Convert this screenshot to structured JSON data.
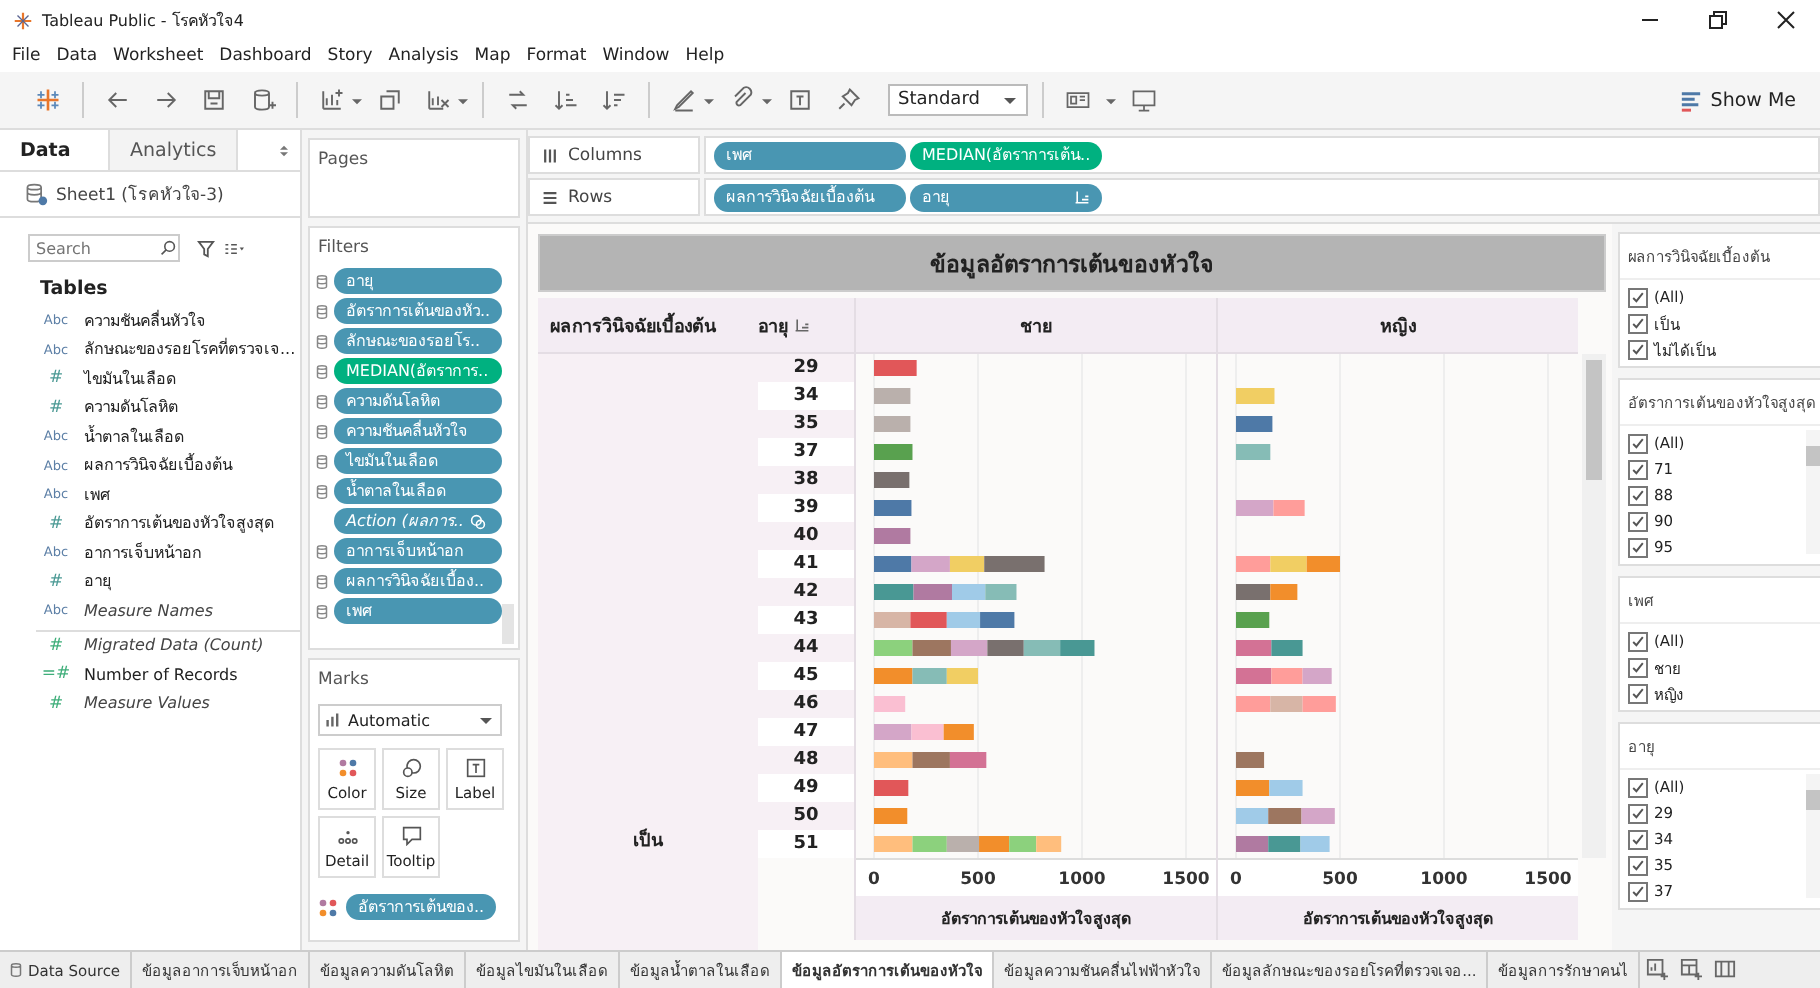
{
  "window": {
    "title": "Tableau Public - โรคหัวใจ4"
  },
  "menu": [
    "File",
    "Data",
    "Worksheet",
    "Dashboard",
    "Story",
    "Analysis",
    "Map",
    "Format",
    "Window",
    "Help"
  ],
  "toolbar": {
    "mark_size": "Standard",
    "show_me": "Show Me"
  },
  "data_pane": {
    "tabs": [
      {
        "label": "Data",
        "selected": true
      },
      {
        "label": "Analytics",
        "selected": false
      }
    ],
    "source": "Sheet1 (โรคหัวใจ-3)",
    "search": {
      "placeholder": "Search"
    },
    "section": "Tables",
    "fields": [
      {
        "type": "Abc",
        "name": "ความชันคลื่นหัวใจ",
        "measure": false,
        "generated": false
      },
      {
        "type": "Abc",
        "name": "ลักษณะของรอยโรคที่ตรวจเจ...",
        "measure": false,
        "generated": false
      },
      {
        "type": "#",
        "name": "ไขมันในเลือด",
        "measure": false,
        "generated": false
      },
      {
        "type": "#",
        "name": "ความดันโลหิต",
        "measure": false,
        "generated": false
      },
      {
        "type": "Abc",
        "name": "น้ำตาลในเลือด",
        "measure": false,
        "generated": false
      },
      {
        "type": "Abc",
        "name": "ผลการวินิจฉัยเบื้องต้น",
        "measure": false,
        "generated": false
      },
      {
        "type": "Abc",
        "name": "เพศ",
        "measure": false,
        "generated": false
      },
      {
        "type": "#",
        "name": "อัตราการเต้นของหัวใจสูงสุด",
        "measure": false,
        "generated": false
      },
      {
        "type": "Abc",
        "name": "อาการเจ็บหน้าอก",
        "measure": false,
        "generated": false
      },
      {
        "type": "#",
        "name": "อายุ",
        "measure": false,
        "generated": false
      },
      {
        "type": "Abc",
        "name": "Measure Names",
        "measure": false,
        "generated": true
      },
      {
        "type": "#",
        "name": "Migrated Data (Count)",
        "measure": true,
        "generated": true
      },
      {
        "type": "=#",
        "name": "Number of Records",
        "measure": true,
        "generated": false
      },
      {
        "type": "#",
        "name": "Measure Values",
        "measure": true,
        "generated": true
      }
    ]
  },
  "pages": {
    "title": "Pages"
  },
  "filters": {
    "title": "Filters",
    "pills": [
      {
        "label": "อายุ",
        "kind": "dimension"
      },
      {
        "label": "อัตราการเต้นของหัว..",
        "kind": "dimension"
      },
      {
        "label": "ลักษณะของรอยโร..",
        "kind": "dimension"
      },
      {
        "label": "MEDIAN(อัตราการ..",
        "kind": "measure"
      },
      {
        "label": "ความดันโลหิต",
        "kind": "dimension"
      },
      {
        "label": "ความชันคลื่นหัวใจ",
        "kind": "dimension"
      },
      {
        "label": "ไขมันในเลือด",
        "kind": "dimension"
      },
      {
        "label": "น้ำตาลในเลือด",
        "kind": "dimension"
      },
      {
        "label": "Action (ผลการ..",
        "kind": "action"
      },
      {
        "label": "อาการเจ็บหน้าอก",
        "kind": "dimension"
      },
      {
        "label": "ผลการวินิจฉัยเบื้อง..",
        "kind": "dimension"
      },
      {
        "label": "เพศ",
        "kind": "dimension"
      }
    ]
  },
  "marks": {
    "title": "Marks",
    "mark_type": "Automatic",
    "cards": [
      "Color",
      "Size",
      "Label",
      "Detail",
      "Tooltip"
    ],
    "color_pill": "อัตราการเต้นของ.."
  },
  "shelves": [
    {
      "kind": "columns",
      "label": "Columns",
      "pills": [
        {
          "label": "เพศ",
          "kind": "dimension",
          "sorted": false
        },
        {
          "label": "MEDIAN(อัตราการเต้น..",
          "kind": "measure",
          "sorted": false
        }
      ]
    },
    {
      "kind": "rows",
      "label": "Rows",
      "pills": [
        {
          "label": "ผลการวินิจฉัยเบื้องต้น",
          "kind": "dimension",
          "sorted": false
        },
        {
          "label": "อายุ",
          "kind": "dimension",
          "sorted": true
        }
      ]
    }
  ],
  "viz": {
    "title": "ข้อมูลอัตราการเต้นของหัวใจ",
    "row_headers": [
      "ผลการวินิจฉัยเบื้องต้น",
      "อายุ"
    ],
    "diagnosis": "เป็น",
    "panes": [
      {
        "header": "ชาย",
        "chart_data": {
          "type": "bar",
          "orientation": "horizontal",
          "stacked": true,
          "xlabel": "อัตราการเต้นของหัวใจสูงสุด",
          "xlim": [
            0,
            1500
          ],
          "xticks": [
            0,
            500,
            1000,
            1500
          ],
          "categories": [
            "29",
            "34",
            "35",
            "37",
            "38",
            "39",
            "40",
            "41",
            "42",
            "43",
            "44",
            "45",
            "46",
            "47",
            "48",
            "49",
            "50",
            "51"
          ],
          "series": [
            {
              "values": [
                205,
                175,
                175,
                185,
                170,
                180,
                175,
                180,
                190,
                175,
                185,
                185,
                150,
                180,
                185,
                165,
                160,
                185
              ],
              "colors": [
                "#e15759",
                "#bab0ac",
                "#bab0ac",
                "#59a14f",
                "#79706e",
                "#4e79a7",
                "#b07aa1",
                "#4e79a7",
                "#499894",
                "#d7b5a6",
                "#8cd17d",
                "#f28e2b",
                "#fabfd2",
                "#d4a6c8",
                "#ffbe7d",
                "#e15759",
                "#f28e2b",
                "#ffbe7d"
              ]
            },
            {
              "values": [
                null,
                null,
                null,
                null,
                null,
                null,
                null,
                185,
                185,
                175,
                185,
                165,
                null,
                155,
                180,
                null,
                null,
                165
              ],
              "colors": [
                null,
                null,
                null,
                null,
                null,
                null,
                null,
                "#d4a6c8",
                "#b07aa1",
                "#e15759",
                "#9d7660",
                "#86bcb6",
                null,
                "#fabfd2",
                "#9d7660",
                null,
                null,
                "#8cd17d"
              ]
            },
            {
              "values": [
                null,
                null,
                null,
                null,
                null,
                null,
                null,
                165,
                160,
                160,
                175,
                150,
                null,
                145,
                175,
                null,
                null,
                155
              ],
              "colors": [
                null,
                null,
                null,
                null,
                null,
                null,
                null,
                "#f1ce63",
                "#a0cbe8",
                "#a0cbe8",
                "#d4a6c8",
                "#f1ce63",
                null,
                "#f28e2b",
                "#d37295",
                null,
                null,
                "#bab0ac"
              ]
            },
            {
              "values": [
                null,
                null,
                null,
                null,
                null,
                null,
                null,
                290,
                150,
                165,
                175,
                null,
                null,
                null,
                null,
                null,
                null,
                145
              ],
              "colors": [
                null,
                null,
                null,
                null,
                null,
                null,
                null,
                "#79706e",
                "#86bcb6",
                "#4e79a7",
                "#79706e",
                null,
                null,
                null,
                null,
                null,
                null,
                "#f28e2b"
              ]
            },
            {
              "values": [
                null,
                null,
                null,
                null,
                null,
                null,
                null,
                null,
                null,
                null,
                175,
                null,
                null,
                null,
                null,
                null,
                null,
                130
              ],
              "colors": [
                null,
                null,
                null,
                null,
                null,
                null,
                null,
                null,
                null,
                null,
                "#86bcb6",
                null,
                null,
                null,
                null,
                null,
                null,
                "#8cd17d"
              ]
            },
            {
              "values": [
                null,
                null,
                null,
                null,
                null,
                null,
                null,
                null,
                null,
                null,
                165,
                null,
                null,
                null,
                null,
                null,
                null,
                120
              ],
              "colors": [
                null,
                null,
                null,
                null,
                null,
                null,
                null,
                null,
                null,
                null,
                "#499894",
                null,
                null,
                null,
                null,
                null,
                null,
                "#ffbe7d"
              ]
            }
          ]
        }
      },
      {
        "header": "หญิง",
        "chart_data": {
          "type": "bar",
          "orientation": "horizontal",
          "stacked": true,
          "xlabel": "อัตราการเต้นของหัวใจสูงสุด",
          "xlim": [
            0,
            1500
          ],
          "xticks": [
            0,
            500,
            1000,
            1500
          ],
          "series": [
            {
              "values": [
                null,
                185,
                175,
                165,
                null,
                180,
                null,
                165,
                165,
                160,
                170,
                170,
                165,
                null,
                135,
                160,
                155,
                155
              ],
              "colors": [
                null,
                "#f1ce63",
                "#4e79a7",
                "#86bcb6",
                null,
                "#d4a6c8",
                null,
                "#ff9d9a",
                "#79706e",
                "#59a14f",
                "#d37295",
                "#d37295",
                "#ff9d9a",
                null,
                "#9d7660",
                "#f28e2b",
                "#a0cbe8",
                "#b07aa1"
              ]
            },
            {
              "values": [
                null,
                null,
                null,
                null,
                null,
                150,
                null,
                175,
                130,
                null,
                150,
                150,
                155,
                null,
                null,
                160,
                160,
                155
              ],
              "colors": [
                null,
                null,
                null,
                null,
                null,
                "#ff9d9a",
                null,
                "#f1ce63",
                "#f28e2b",
                null,
                "#499894",
                "#ff9d9a",
                "#d7b5a6",
                null,
                null,
                "#a0cbe8",
                "#9d7660",
                "#499894"
              ]
            },
            {
              "values": [
                null,
                null,
                null,
                null,
                null,
                null,
                null,
                160,
                null,
                null,
                null,
                140,
                160,
                null,
                null,
                null,
                160,
                140
              ],
              "colors": [
                null,
                null,
                null,
                null,
                null,
                null,
                null,
                "#f28e2b",
                null,
                null,
                null,
                "#d4a6c8",
                "#ff9d9a",
                null,
                null,
                null,
                "#d4a6c8",
                "#a0cbe8"
              ]
            }
          ]
        }
      }
    ]
  },
  "filter_cards": [
    {
      "title": "ผลการวินิจฉัยเบื้องต้น",
      "scrollable": false,
      "items": [
        {
          "label": "(All)",
          "checked": true
        },
        {
          "label": "เป็น",
          "checked": true
        },
        {
          "label": "ไม่ได้เป็น",
          "checked": true
        }
      ]
    },
    {
      "title": "อัตราการเต้นของหัวใจสูงสุด",
      "scrollable": true,
      "items": [
        {
          "label": "(All)",
          "checked": true
        },
        {
          "label": "71",
          "checked": true
        },
        {
          "label": "88",
          "checked": true
        },
        {
          "label": "90",
          "checked": true
        },
        {
          "label": "95",
          "checked": true
        }
      ]
    },
    {
      "title": "เพศ",
      "scrollable": false,
      "items": [
        {
          "label": "(All)",
          "checked": true
        },
        {
          "label": "ชาย",
          "checked": true
        },
        {
          "label": "หญิง",
          "checked": true
        }
      ]
    },
    {
      "title": "อายุ",
      "scrollable": true,
      "items": [
        {
          "label": "(All)",
          "checked": true
        },
        {
          "label": "29",
          "checked": true
        },
        {
          "label": "34",
          "checked": true
        },
        {
          "label": "35",
          "checked": true
        },
        {
          "label": "37",
          "checked": true
        }
      ]
    }
  ],
  "sheet_tabs": [
    {
      "label": "Data Source",
      "kind": "source",
      "selected": false
    },
    {
      "label": "ข้อมูลอาการเจ็บหน้าอก",
      "kind": "sheet",
      "selected": false
    },
    {
      "label": "ข้อมูลความดันโลหิต",
      "kind": "sheet",
      "selected": false
    },
    {
      "label": "ข้อมูลไขมันในเลือด",
      "kind": "sheet",
      "selected": false
    },
    {
      "label": "ข้อมูลน้ำตาลในเลือด",
      "kind": "sheet",
      "selected": false
    },
    {
      "label": "ข้อมูลอัตราการเต้นของหัวใจ",
      "kind": "sheet",
      "selected": true
    },
    {
      "label": "ข้อมูลความชันคลื่นไฟฟ้าหัวใจ",
      "kind": "sheet",
      "selected": false
    },
    {
      "label": "ข้อมูลลักษณะของรอยโรคที่ตรวจเจอ...",
      "kind": "sheet",
      "selected": false
    },
    {
      "label": "ข้อมูลการรักษาคนไ",
      "kind": "sheet",
      "selected": false
    }
  ]
}
